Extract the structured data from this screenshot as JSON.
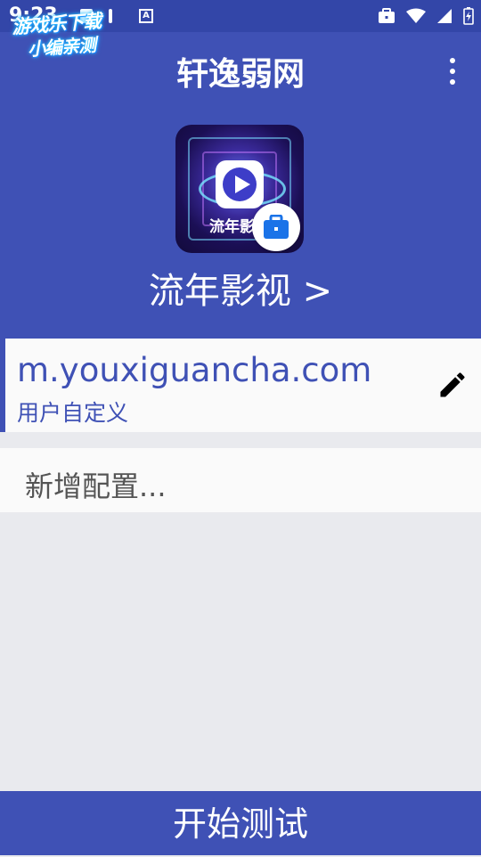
{
  "status_bar": {
    "time": "9:23",
    "icons": [
      "image-icon",
      "pause-icon",
      "font-a-icon",
      "briefcase-icon",
      "wifi-icon",
      "signal-icon",
      "battery-icon"
    ],
    "font_icon_letter": "A"
  },
  "watermark": {
    "line1": "游戏乐下载",
    "line2": "小编亲测"
  },
  "header": {
    "title": "轩逸弱网",
    "menu_icon": "more-vert-icon",
    "app_icon_caption": "流年影视",
    "app_name": "流年影视 >",
    "badge_icon": "work-profile-briefcase-icon",
    "color": "#3f51b5"
  },
  "config_list": {
    "items": [
      {
        "domain": "m.youxiguancha.com",
        "type": "用户自定义",
        "action_icon": "edit-icon"
      }
    ],
    "add_label": "新增配置..."
  },
  "footer": {
    "start_label": "开始测试"
  },
  "colors": {
    "primary": "#3f51b5",
    "status_bar": "#3346a8",
    "background": "#e9eaee",
    "card": "#fafafa",
    "badge_icon": "#1a73e8"
  }
}
